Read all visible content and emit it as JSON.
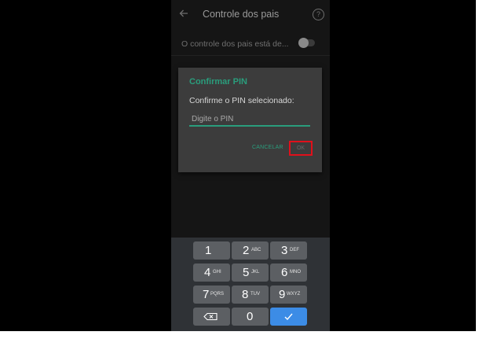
{
  "app_bar": {
    "title": "Controle dos pais",
    "back_icon": "arrow-left-icon",
    "help_icon": "help-circle-icon",
    "help_glyph": "?"
  },
  "setting": {
    "label": "O controle dos pais está de...",
    "toggle_state": "off"
  },
  "dialog": {
    "title": "Confirmar PIN",
    "message": "Confirme o PIN selecionado:",
    "input_placeholder": "Digite o PIN",
    "input_value": "",
    "cancel_label": "CANCELAR",
    "ok_label": "OK"
  },
  "keypad": {
    "keys": [
      {
        "num": "1",
        "letters": ""
      },
      {
        "num": "2",
        "letters": "ABC"
      },
      {
        "num": "3",
        "letters": "DEF"
      },
      {
        "num": "4",
        "letters": "GHI"
      },
      {
        "num": "5",
        "letters": "JKL"
      },
      {
        "num": "6",
        "letters": "MNO"
      },
      {
        "num": "7",
        "letters": "PQRS"
      },
      {
        "num": "8",
        "letters": "TUV"
      },
      {
        "num": "9",
        "letters": "WXYZ"
      },
      {
        "num": "0",
        "letters": ""
      }
    ],
    "backspace_icon": "backspace-icon",
    "done_icon": "check-icon"
  },
  "colors": {
    "accent": "#2a9d7c",
    "highlight": "#e0101b",
    "done_key": "#3c8ce6",
    "background": "#151515"
  }
}
